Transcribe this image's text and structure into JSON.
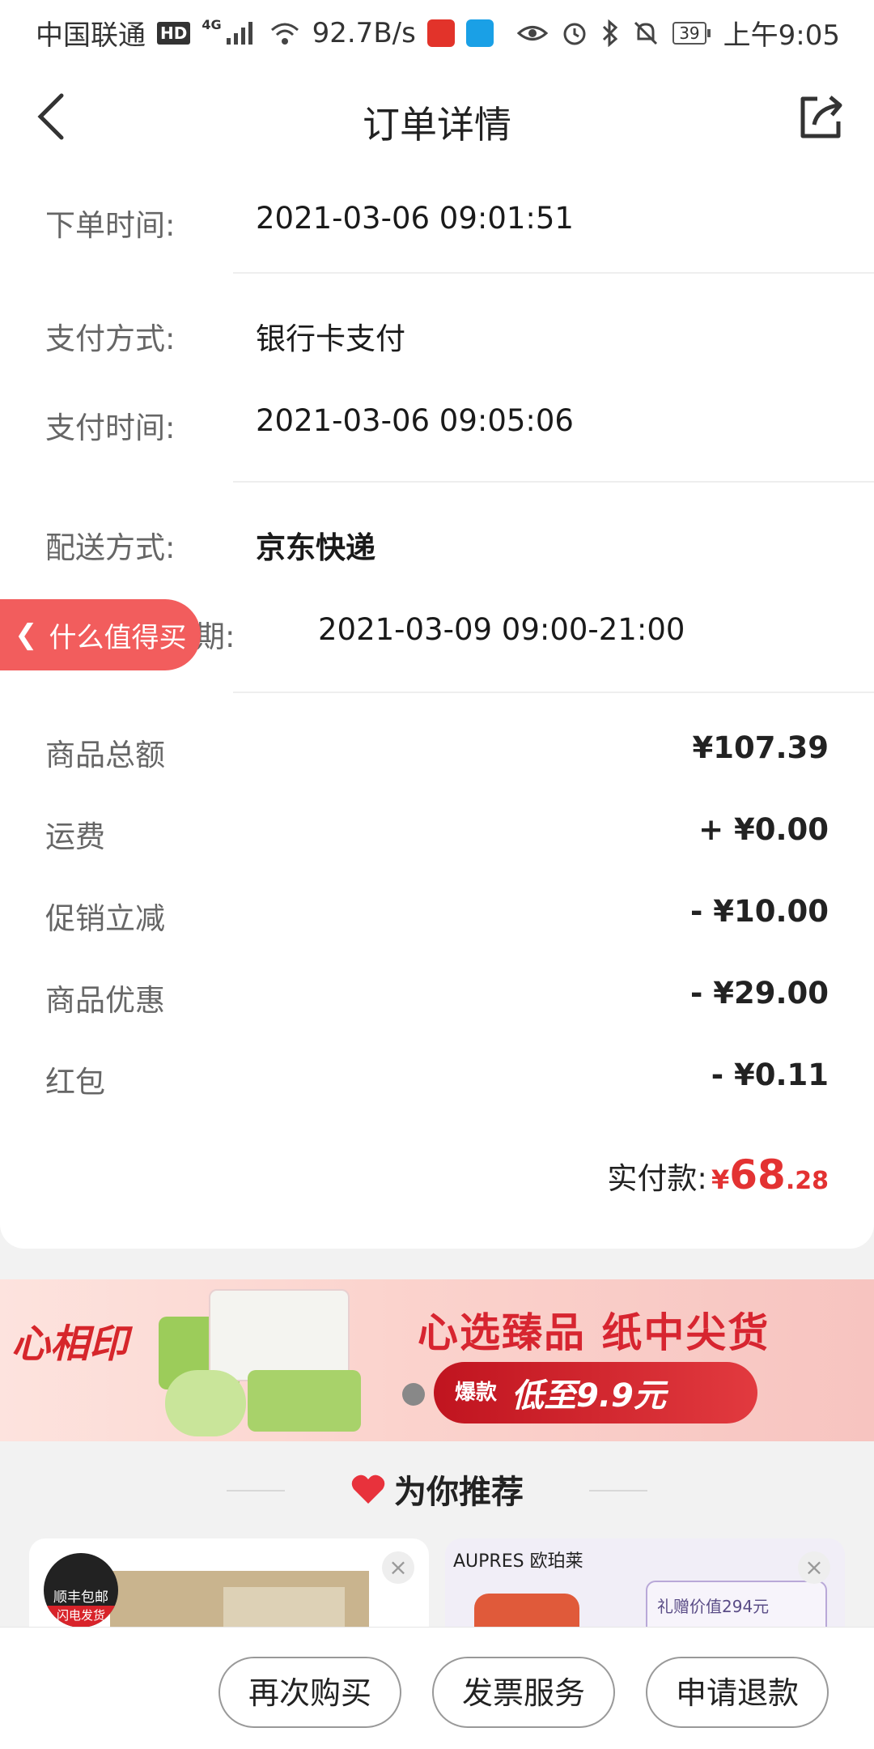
{
  "status_bar": {
    "carrier": "中国联通",
    "hd": "HD",
    "network": "4G",
    "speed": "92.7B/s",
    "battery": "39",
    "time": "上午9:05"
  },
  "nav": {
    "title": "订单详情"
  },
  "order_info": [
    {
      "label": "下单时间:",
      "value": "2021-03-06 09:01:51"
    },
    {
      "label": "支付方式:",
      "value": "银行卡支付"
    },
    {
      "label": "支付时间:",
      "value": "2021-03-06 09:05:06"
    },
    {
      "label": "配送方式:",
      "value": "京东快递"
    },
    {
      "label": "期望配送日期:",
      "value": "2021-03-09 09:00-21:00"
    }
  ],
  "fees": [
    {
      "label": "商品总额",
      "value": "¥107.39"
    },
    {
      "label": "运费",
      "value": "+ ¥0.00"
    },
    {
      "label": "促销立减",
      "value": "- ¥10.00"
    },
    {
      "label": "商品优惠",
      "value": "- ¥29.00"
    },
    {
      "label": "红包",
      "value": "- ¥0.11"
    }
  ],
  "total": {
    "label": "实付款:",
    "currency": "¥",
    "integer": "68",
    "decimal": ".28"
  },
  "float_pill": {
    "label": "什么值得买"
  },
  "banner": {
    "brand": "心相印",
    "title": "心选臻品 纸中尖货",
    "tag": "爆款",
    "cta": "低至9.9元"
  },
  "recommend": {
    "title": "为你推荐",
    "card1_badge_top": "顺丰包邮",
    "card1_badge_bottom": "闪电发货",
    "card2_brand": "AUPRES 欧珀莱",
    "card2_gift": "礼赠价值294元"
  },
  "bottom_bar": {
    "buy_again": "再次购买",
    "invoice": "发票服务",
    "refund": "申请退款"
  },
  "colors": {
    "accent_red": "#e33232",
    "pill_red": "#f25d5d"
  }
}
